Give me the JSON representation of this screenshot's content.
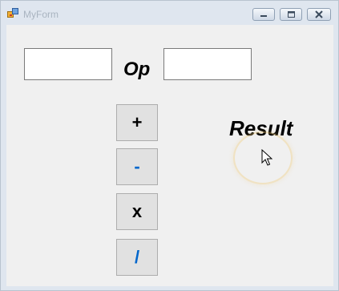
{
  "window": {
    "title": "MyForm"
  },
  "form": {
    "operand1_value": "",
    "operand2_value": "",
    "op_label": "Op",
    "result_label": "Result"
  },
  "buttons": {
    "add": "+",
    "subtract": "-",
    "multiply": "x",
    "divide": "/"
  },
  "colors": {
    "text_black": "#000000",
    "text_blue": "#0066cc",
    "button_face": "#e1e1e1",
    "form_back": "#f0f0f0",
    "title_text": "#a9b4c0"
  }
}
